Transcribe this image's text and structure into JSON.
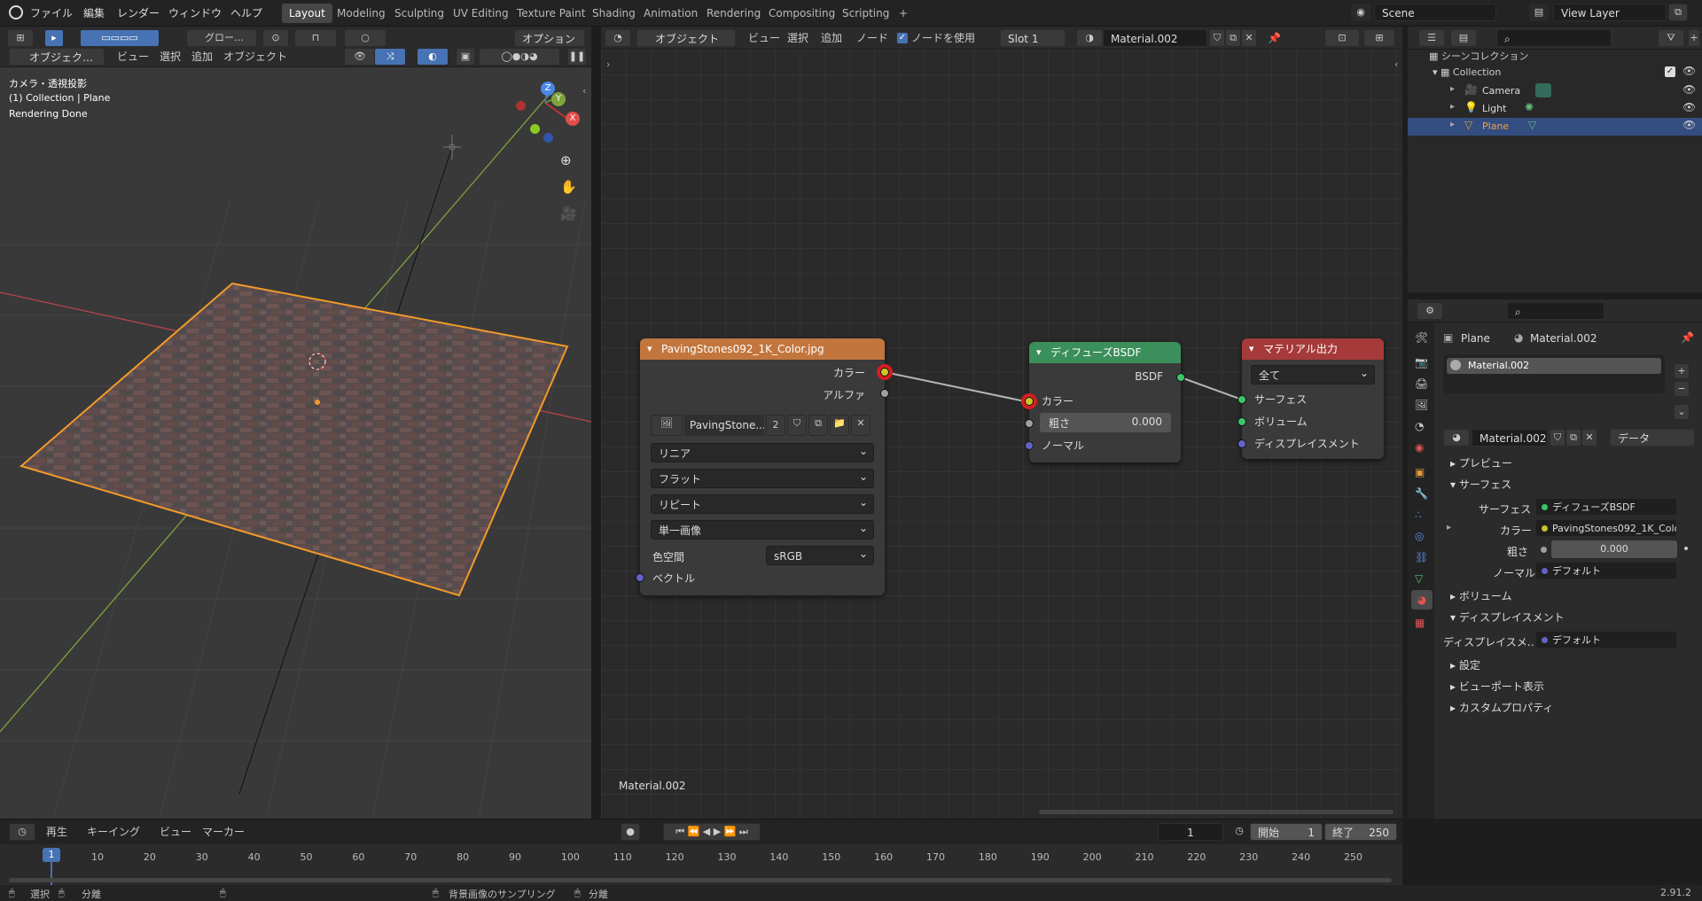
{
  "menubar": {
    "items": [
      "ファイル",
      "編集",
      "レンダー",
      "ウィンドウ",
      "ヘルプ"
    ],
    "workspaces": [
      "Layout",
      "Modeling",
      "Sculpting",
      "UV Editing",
      "Texture Paint",
      "Shading",
      "Animation",
      "Rendering",
      "Compositing",
      "Scripting"
    ],
    "active_workspace": "Layout",
    "add_tab": "+",
    "scene": "Scene",
    "view_layer": "View Layer"
  },
  "viewport": {
    "mode": "オブジェク…",
    "menu": [
      "ビュー",
      "選択",
      "追加",
      "オブジェクト"
    ],
    "transform_orientation": "グロー…",
    "options": "オプション",
    "overlay_lines": [
      "カメラ・透視投影",
      "(1) Collection | Plane",
      "Rendering Done"
    ],
    "axes": {
      "x": "X",
      "y": "Y",
      "z": "Z"
    }
  },
  "node_editor": {
    "editor_mode": "オブジェクト",
    "menu": [
      "ビュー",
      "選択",
      "追加",
      "ノード"
    ],
    "use_nodes_label": "ノードを使用",
    "slot": "Slot 1",
    "material_name": "Material.002",
    "footer_label": "Material.002",
    "image_node": {
      "title": "PavingStones092_1K_Color.jpg",
      "outputs": [
        "カラー",
        "アルファ"
      ],
      "image_name": "PavingStone...",
      "users": "2",
      "interpolation": "リニア",
      "projection": "フラット",
      "extension": "リピート",
      "source": "単一画像",
      "colorspace_label": "色空間",
      "colorspace": "sRGB",
      "vector_input": "ベクトル"
    },
    "diffuse_node": {
      "title": "ディフューズBSDF",
      "output": "BSDF",
      "color_input": "カラー",
      "roughness_label": "粗さ",
      "roughness_value": "0.000",
      "normal_input": "ノーマル"
    },
    "output_node": {
      "title": "マテリアル出力",
      "target": "全て",
      "inputs": [
        "サーフェス",
        "ボリューム",
        "ディスプレイスメント"
      ]
    }
  },
  "outliner": {
    "scene_collection": "シーンコレクション",
    "collection": "Collection",
    "items": [
      {
        "name": "Camera",
        "selected": false
      },
      {
        "name": "Light",
        "selected": false
      },
      {
        "name": "Plane",
        "selected": true
      }
    ]
  },
  "properties": {
    "object_name": "Plane",
    "material_name": "Material.002",
    "slot_item": "Material.002",
    "material_field": "Material.002",
    "link_mode": "データ",
    "sections": {
      "preview": "プレビュー",
      "surface": "サーフェス",
      "volume": "ボリューム",
      "displacement": "ディスプレイスメント",
      "settings": "設定",
      "viewport_display": "ビューポート表示",
      "custom_props": "カスタムプロパティ"
    },
    "surface_label": "サーフェス",
    "surface_value": "ディフューズBSDF",
    "color_label": "カラー",
    "color_value": "PavingStones092_1K_Colo...",
    "roughness_label": "粗さ",
    "roughness_value": "0.000",
    "normal_label": "ノーマル",
    "normal_value": "デフォルト",
    "displacement_label": "ディスプレイスメ…",
    "displacement_value": "デフォルト"
  },
  "timeline": {
    "menu": [
      "再生",
      "キーイング",
      "ビュー",
      "マーカー"
    ],
    "current_frame": "1",
    "start_label": "開始",
    "start_value": "1",
    "end_label": "終了",
    "end_value": "250",
    "ticks": [
      "1",
      "10",
      "20",
      "30",
      "40",
      "50",
      "60",
      "70",
      "80",
      "90",
      "100",
      "110",
      "120",
      "130",
      "140",
      "150",
      "160",
      "170",
      "180",
      "190",
      "200",
      "210",
      "220",
      "230",
      "240",
      "250"
    ]
  },
  "statusbar": {
    "select": "選択",
    "split1": "分離",
    "sample": "背景画像のサンプリング",
    "split2": "分離",
    "version": "2.91.2"
  },
  "colors": {
    "accent": "#4772b3",
    "image_node_header": "#c2763d",
    "shader_node_header": "#3b8f5a",
    "output_node_header": "#a63a3a",
    "color_socket": "#c7c729",
    "selection_outline": "#f39a2a"
  }
}
